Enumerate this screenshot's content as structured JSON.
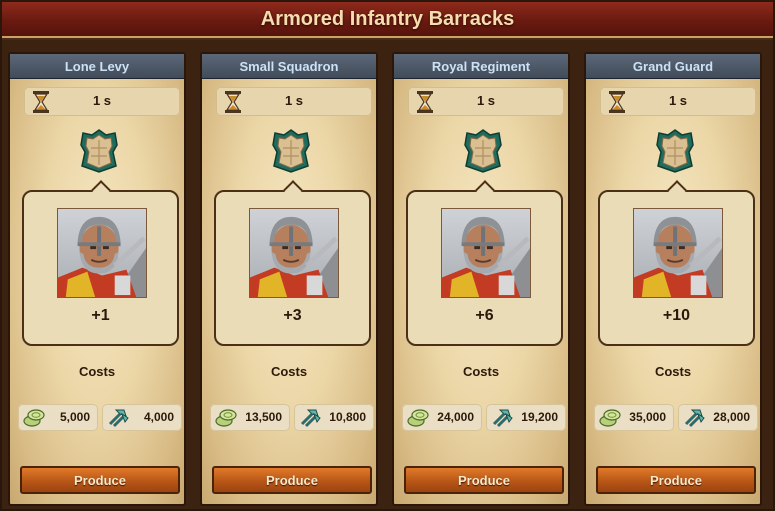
{
  "window": {
    "title": "Armored Infantry Barracks"
  },
  "cards": [
    {
      "name": "Lone Levy",
      "time": "1 s",
      "amount": "+1",
      "costs_label": "Costs",
      "cost_coins": "5,000",
      "cost_supplies": "4,000",
      "button": "Produce"
    },
    {
      "name": "Small Squadron",
      "time": "1 s",
      "amount": "+3",
      "costs_label": "Costs",
      "cost_coins": "13,500",
      "cost_supplies": "10,800",
      "button": "Produce"
    },
    {
      "name": "Royal Regiment",
      "time": "1 s",
      "amount": "+6",
      "costs_label": "Costs",
      "cost_coins": "24,000",
      "cost_supplies": "19,200",
      "button": "Produce"
    },
    {
      "name": "Grand Guard",
      "time": "1 s",
      "amount": "+10",
      "costs_label": "Costs",
      "cost_coins": "35,000",
      "cost_supplies": "28,000",
      "button": "Produce"
    }
  ],
  "icons": {
    "time": "hourglass-icon",
    "unit_type": "armored-infantry-icon",
    "coins": "coins-icon",
    "supplies": "supplies-icon"
  },
  "colors": {
    "title_bar": "#7a2014",
    "card_header": "#4b5563",
    "button": "#c2601b"
  }
}
